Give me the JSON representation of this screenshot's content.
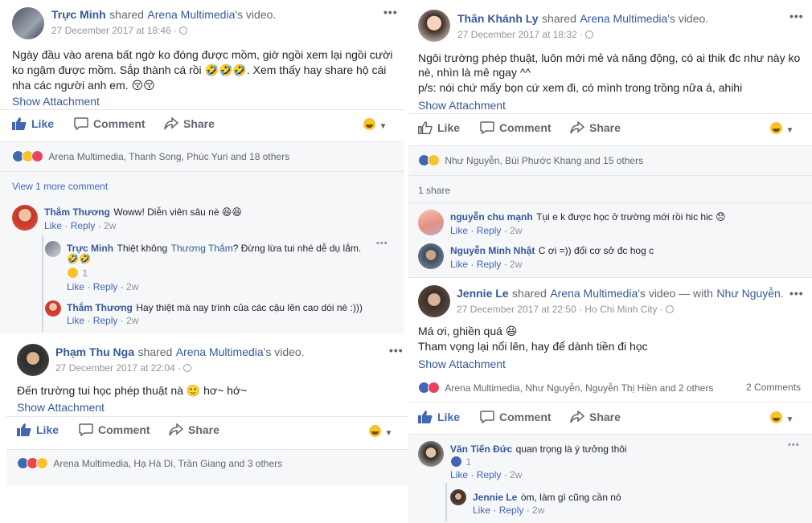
{
  "post1": {
    "author": "Trực Minh",
    "shared_word": "shared",
    "page": "Arena Multimedia",
    "page_suffix": "'s video.",
    "time": "27 December 2017 at 18:46",
    "line1": "Ngày đầu vào arena bất ngờ ko đóng được mồm, giờ ngồi xem lại ngồi cười",
    "line2": "ko ngậm được mồm. Sắp thành cá rồi 🤣🤣🤣. Xem thấy hay share hộ cái",
    "line3": "nha các người anh em. 😚😚",
    "attachment": "Show Attachment",
    "like": "Like",
    "comment": "Comment",
    "share": "Share",
    "reactions": "Arena Multimedia, Thanh Song, Phúc Yuri and 18 others",
    "more_comments": "View 1 more comment",
    "c1_name": "Thắm Thương",
    "c1_text": "Woww! Diễn viên sâu nè 😆😆",
    "c1_like": "Like",
    "c1_reply": "Reply",
    "c1_time": "2w",
    "r1_name": "Trực Minh",
    "r1_text_a": "Thiệt không",
    "r1_tag": "Thương Thắm",
    "r1_text_b": "? Đừng lừa tui nhé dễ dụ lắm.",
    "r1_emoji": "🤣🤣",
    "r1_count": "1",
    "r1_like": "Like",
    "r1_reply": "Reply",
    "r1_time": "2w",
    "r2_name": "Thắm Thương",
    "r2_text": "Hay thiệt mà nay trình của các cậu lên cao dòi nè :)))",
    "r2_like": "Like",
    "r2_reply": "Reply",
    "r2_time": "2w"
  },
  "post2": {
    "author": "Thân Khánh Ly",
    "shared_word": "shared",
    "page": "Arena Multimedia",
    "page_suffix": "'s video.",
    "time": "27 December 2017 at 18:32",
    "line1": "Ngôi trường phép thuật, luôn mới mẻ và năng động, có ai thik đc như này ko",
    "line2": "nè, nhìn là mê ngay ^^",
    "line3": "p/s: nói chứ mấy bọn cứ xem đi, có mình trong trồng nữa á, ahihi",
    "attachment": "Show Attachment",
    "like": "Like",
    "comment": "Comment",
    "share": "Share",
    "reactions": "Như Nguyễn, Bùi Phước Khang and 15 others",
    "shares": "1 share",
    "c1_name": "nguyễn chu mạnh",
    "c1_text": "Tụi e k được học ở trường mới rồi hic hic 😞",
    "c1_like": "Like",
    "c1_reply": "Reply",
    "c1_time": "2w",
    "c2_name": "Nguyễn Minh Nhật",
    "c2_text": "C ơi =)) đổi cơ sở đc hog c",
    "c2_like": "Like",
    "c2_reply": "Reply",
    "c2_time": "2w"
  },
  "post3": {
    "author": "Jennie Le",
    "shared_word": "shared",
    "page": "Arena Multimedia",
    "page_suffix": "'s video — with",
    "with_name": "Như Nguyễn",
    "with_end": ".",
    "time": "27 December 2017 at 22:50 · Ho Chi Minh City ·",
    "line1": "Má ơi, ghiền quá 😆",
    "line2": "Tham vọng lại nổi lên, hay để dành tiền đi học",
    "attachment": "Show Attachment",
    "reactions": "Arena Multimedia, Như Nguyễn, Nguyễn Thị Hiền and 2 others",
    "comments_count": "2 Comments",
    "like": "Like",
    "comment": "Comment",
    "share": "Share",
    "c1_name": "Văn Tiến Đức",
    "c1_text": "quan trọng là ý tưởng thôi",
    "c1_count": "1",
    "c1_like": "Like",
    "c1_reply": "Reply",
    "c1_time": "2w",
    "r1_name": "Jennie Le",
    "r1_text": "òm, làm gì cũng cần nó",
    "r1_like": "Like",
    "r1_reply": "Reply",
    "r1_time": "2w"
  },
  "post4": {
    "author": "Phạm Thu Nga",
    "shared_word": "shared",
    "page": "Arena Multimedia",
    "page_suffix": "'s video.",
    "time": "27 December 2017 at 22:04 ·",
    "line1": "Đến trường tui học phép thuật nà 🙂 hơ~ hớ~",
    "attachment": "Show Attachment",
    "like": "Like",
    "comment": "Comment",
    "share": "Share",
    "reactions": "Arena Multimedia, Hạ Hà Di, Trần Giang and 3 others"
  },
  "colors": {
    "link": "#365899",
    "like_blue": "#4267b2",
    "text": "#1d2129",
    "muted": "#90949c"
  }
}
